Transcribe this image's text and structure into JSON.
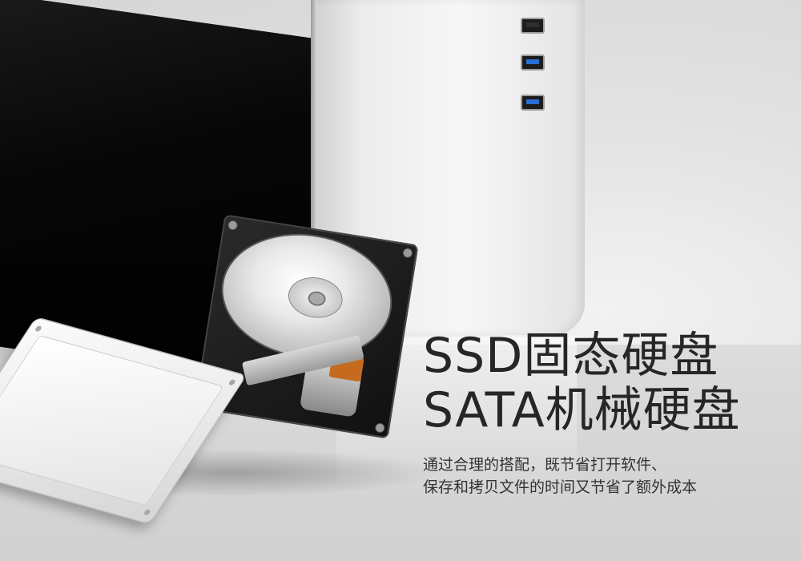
{
  "headline": {
    "line1": "SSD固态硬盘",
    "line2": "SATA机械硬盘"
  },
  "description": {
    "line1": "通过合理的搭配，既节省打开软件、",
    "line2": "保存和拷贝文件的时间又节省了额外成本"
  },
  "front_ports": [
    "usb2-port",
    "usb3-port",
    "usb3-port"
  ],
  "colors": {
    "background": "#e6e6e6",
    "headline_text": "#262626",
    "body_text": "#333333",
    "usb3_accent": "#2a6fd6",
    "hdd_copper": "#c56b1f"
  }
}
